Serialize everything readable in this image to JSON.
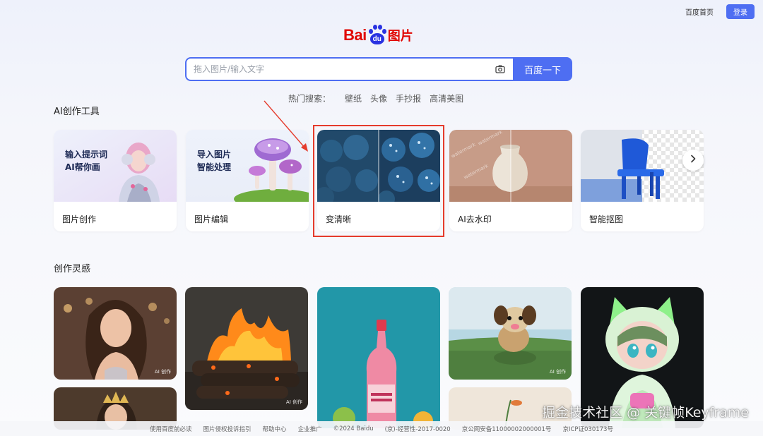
{
  "topbar": {
    "home_link": "百度首页",
    "login_label": "登录"
  },
  "logo": {
    "bai": "Bai",
    "du": "du",
    "zh": "图片"
  },
  "search": {
    "placeholder": "拖入图片/输入文字",
    "button_label": "百度一下"
  },
  "hot_search": {
    "label": "热门搜索：",
    "items": [
      "壁纸",
      "头像",
      "手抄报",
      "高清美图"
    ]
  },
  "ai_tools": {
    "title": "AI创作工具",
    "cards": [
      {
        "label": "图片创作",
        "thumb_text": [
          "输入提示词",
          "AI帮你画"
        ]
      },
      {
        "label": "图片编辑",
        "thumb_text": [
          "导入图片",
          "智能处理"
        ]
      },
      {
        "label": "变清晰"
      },
      {
        "label": "AI去水印",
        "thumb_overlay": "watermark"
      },
      {
        "label": "智能抠图"
      }
    ],
    "highlighted_card": "变清晰"
  },
  "inspiration": {
    "title": "创作灵感",
    "ai_tag": "AI 创作"
  },
  "footer": {
    "links": [
      "使用百度前必读",
      "图片侵权投诉指引",
      "帮助中心",
      "企业推广",
      "©2024 Baidu",
      "(京)-经营性-2017-0020",
      "京公网安备11000002000001号",
      "京ICP证030173号"
    ]
  },
  "watermark_text": "掘金技术社区 @ 关键帧Keyframe",
  "colors": {
    "accent": "#4e6ef2",
    "logo_red": "#e10602",
    "logo_blue": "#2932e1",
    "highlight": "#e53b2c"
  }
}
